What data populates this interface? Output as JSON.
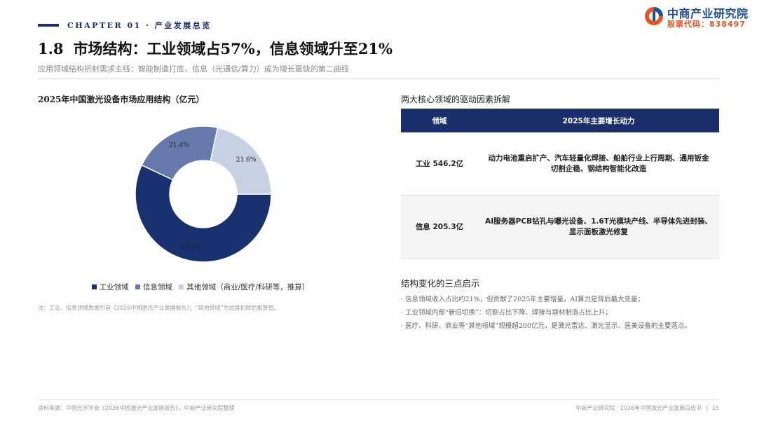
{
  "header": {
    "chapter": "CHAPTER 01 · 产业发展总览",
    "logo_name": "中商产业研究院",
    "logo_code": "股票代码：838497"
  },
  "title": {
    "number": "1.8",
    "text": "市场结构：工业领域占57%，信息领域升至21%"
  },
  "subtitle": "应用领域结构折射需求主线：智能制造打底，信息（光通信/算力）成为增长最快的第二曲线",
  "chart_title": "2025年中国激光设备市场应用结构（亿元）",
  "chart_data": {
    "type": "pie",
    "donut": true,
    "title": "2025年中国激光设备市场应用结构（亿元）",
    "categories": [
      "工业领域",
      "信息领域",
      "其他领域（商业/医疗/科研等，推算）"
    ],
    "values": [
      57.0,
      21.4,
      21.6
    ],
    "labels": [
      "57.0%",
      "21.4%",
      "21.6%"
    ],
    "colors": [
      "#1a3170",
      "#6579ac",
      "#c8d1e3"
    ],
    "legend_position": "bottom"
  },
  "note": "注：工业、信息领域数据引自《2026中国激光产业发展报告》；“其他领域”为总盘扣除后推算值。",
  "table_title": "两大核心领域的驱动因素拆解",
  "table": {
    "headers": [
      "领域",
      "2025年主要增长动力"
    ],
    "rows": [
      {
        "domain": "工业 546.2亿",
        "line1": "动力电池重启扩产、汽车轻量化焊接、船舶行业上行周期、通用钣金",
        "line2": "切割企稳、钢结构智能化改造"
      },
      {
        "domain": "信息 205.3亿",
        "line1": "AI服务器PCB钻孔与曝光设备、1.6T光模块产线、半导体先进封装、",
        "line2": "显示面板激光修复"
      }
    ]
  },
  "insights_title": "结构变化的三点启示",
  "insights": [
    "信息领域收入占比约21%，但贡献了2025年主要增量，AI算力是背后最大变量；",
    "工业领域内部“新旧切换”：切割占比下降、焊接与增材制造占比上升；",
    "医疗、科研、商业等“其他领域”规模超200亿元，是激光雷达、激光显示、医美设备的主要落点。"
  ],
  "footer": {
    "source": "资料来源：中国光学学会《2026中国激光产业发展报告》，中商产业研究院整理",
    "org": "中商产业研究院 · 2026年中国激光产业发展白皮书",
    "sep": "|",
    "page": "15"
  }
}
